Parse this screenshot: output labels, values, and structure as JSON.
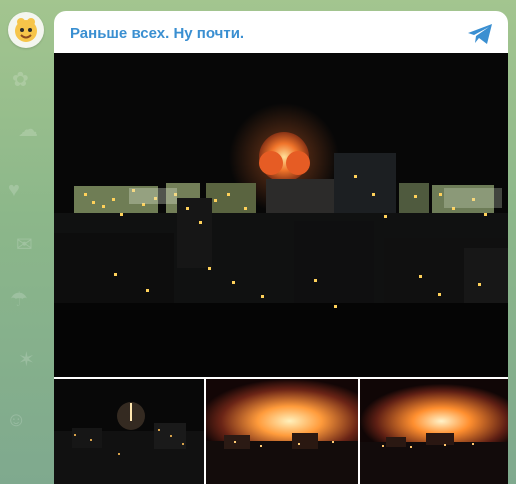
{
  "channel": {
    "name": "Раньше всех. Ну почти.",
    "avatar_icon": "cartoon-face-icon",
    "share_icon": "telegram-paper-plane-icon",
    "accent_color": "#3a8fd1"
  },
  "message": {
    "media": [
      {
        "name": "main-photo",
        "description_icon": "night-city-explosion-image"
      },
      {
        "name": "thumb-1",
        "description_icon": "night-city-flare-image"
      },
      {
        "name": "thumb-2",
        "description_icon": "night-city-fire-image"
      },
      {
        "name": "thumb-3",
        "description_icon": "night-city-fire-image"
      }
    ]
  }
}
